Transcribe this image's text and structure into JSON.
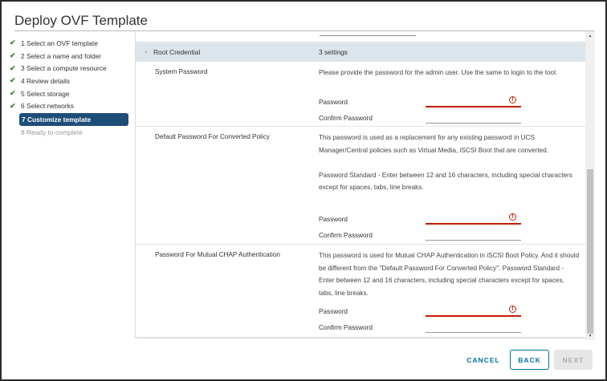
{
  "title": "Deploy OVF Template",
  "nav": [
    {
      "label": "1 Select an OVF template",
      "state": "done"
    },
    {
      "label": "2 Select a name and folder",
      "state": "done"
    },
    {
      "label": "3 Select a compute resource",
      "state": "done"
    },
    {
      "label": "4 Review details",
      "state": "done"
    },
    {
      "label": "5 Select storage",
      "state": "done"
    },
    {
      "label": "6 Select networks",
      "state": "done"
    },
    {
      "label": "7 Customize template",
      "state": "active"
    },
    {
      "label": "8 Ready to complete",
      "state": "disabled"
    }
  ],
  "section": {
    "name": "Root Credential",
    "count": "3 settings"
  },
  "rows": [
    {
      "name": "System Password",
      "desc": "Please provide the password for the admin user. Use the same to login to the tool.",
      "password_label": "Password",
      "confirm_label": "Confirm Password"
    },
    {
      "name": "Default Password For Converted Policy",
      "desc": "This password is used as a replacement for any existing password in UCS Manager/Central policies such as Virtual Media, iSCSI Boot that are converted.",
      "desc2": "Password Standard - Enter between 12 and 16 characters, including special characters except for spaces, tabs, line breaks.",
      "password_label": "Password",
      "confirm_label": "Confirm Password"
    },
    {
      "name": "Password For Mutual CHAP Authentication",
      "desc": "This password is used for Mutual CHAP Authentication in iSCSI Boot Policy. And it should be different from the \"Default Password For Converted Policy\". Password Standard - Enter between 12 and 16 characters, including special characters except for spaces, tabs, line breaks.",
      "password_label": "Password",
      "confirm_label": "Confirm Password"
    }
  ],
  "buttons": {
    "cancel": "CANCEL",
    "back": "BACK",
    "next": "NEXT"
  },
  "colors": {
    "accent": "#0072a3",
    "active_nav": "#1e4d78",
    "error": "#c21d00"
  }
}
